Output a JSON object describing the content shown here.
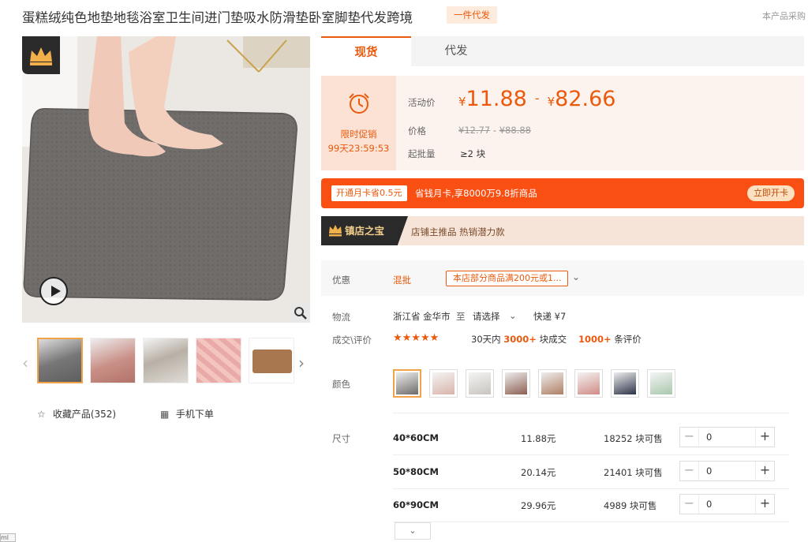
{
  "product": {
    "title": "蛋糕绒纯色地垫地毯浴室卫生间进门垫吸水防滑垫卧室脚垫代发跨境",
    "badge": "一件代发",
    "right_note": "本产品采购"
  },
  "gallery": {
    "prev_arrow": "‹",
    "next_arrow": "›",
    "thumbnails": [
      "灰色",
      "粉色",
      "白色",
      "粉色毛绒",
      "咖啡色"
    ]
  },
  "actions": {
    "collect_label": "收藏产品(352)",
    "mobile_label": "手机下单",
    "collect_icon": "star-icon",
    "mobile_icon": "qr-code-icon"
  },
  "tabs": [
    {
      "label": "现货"
    },
    {
      "label": "代发"
    }
  ],
  "price": {
    "promo_label": "限时促销",
    "countdown": "99天23:59:53",
    "activity_label": "活动价",
    "currency": "¥",
    "activity_low": "11.88",
    "activity_high": "82.66",
    "dash": "-",
    "price_label": "价格",
    "orig_low": "¥12.77",
    "orig_high": "¥88.88",
    "orig_sep": "-",
    "moq_label": "起批量",
    "moq_value": "≥2 块"
  },
  "month_card": {
    "tag": "开通月卡省0.5元",
    "text": "省钱月卡,享8000万9.8折商品",
    "button": "立即开卡"
  },
  "treasure": {
    "label": "镇店之宝",
    "text": "店铺主推品  热销潜力款"
  },
  "coupon": {
    "label": "优惠",
    "type": "混批",
    "tag": "本店部分商品满200元或1...",
    "arrow": "⌄"
  },
  "logistics": {
    "label": "物流",
    "from": "浙江省 金华市",
    "to": "至",
    "select": "请选择",
    "select_arrow": "⌄",
    "shipping": "快递 ¥7"
  },
  "deals": {
    "label": "成交\\评价",
    "stars": "★★★★★",
    "days_prefix": "30天内",
    "deal_count": "3000+",
    "deal_suffix": "块成交",
    "review_count": "1000+",
    "review_suffix": "条评价"
  },
  "color": {
    "label": "颜色",
    "swatches": [
      "#6e6c6a",
      "#d8b4aa",
      "#e8e5e0",
      "#8c5f52",
      "#b07f64",
      "#cf8b84",
      "#2c3248",
      "#a9c8ad"
    ]
  },
  "size": {
    "label": "尺寸",
    "rows": [
      {
        "name": "40*60CM",
        "price": "11.88元",
        "stock": "18252 块可售",
        "qty": "0"
      },
      {
        "name": "50*80CM",
        "price": "20.14元",
        "stock": "21401 块可售",
        "qty": "0"
      },
      {
        "name": "60*90CM",
        "price": "29.96元",
        "stock": "4989 块可售",
        "qty": "0"
      }
    ],
    "minus": "−",
    "plus": "+",
    "more": "⌄"
  },
  "corner": "ml"
}
